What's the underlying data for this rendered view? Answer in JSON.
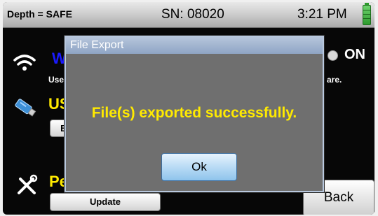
{
  "status_bar": {
    "depth": "Depth = SAFE",
    "serial": "SN: 08020",
    "time": "3:21 PM"
  },
  "background": {
    "wifi_title_partial": "Wi",
    "wifi_desc_left": "Use",
    "wifi_desc_right": "are.",
    "wifi_toggle": "ON",
    "usb_title_partial": "US",
    "export_btn_partial": "E",
    "perf_title_partial": "Pe",
    "update_button": "Update",
    "back_button": "Back"
  },
  "dialog": {
    "title": "File Export",
    "message": "File(s) exported successfully.",
    "ok_button": "Ok"
  },
  "colors": {
    "message": "#ffea00",
    "wifi_title": "#1a1aff",
    "dialog_bg": "#6f6f6f"
  }
}
